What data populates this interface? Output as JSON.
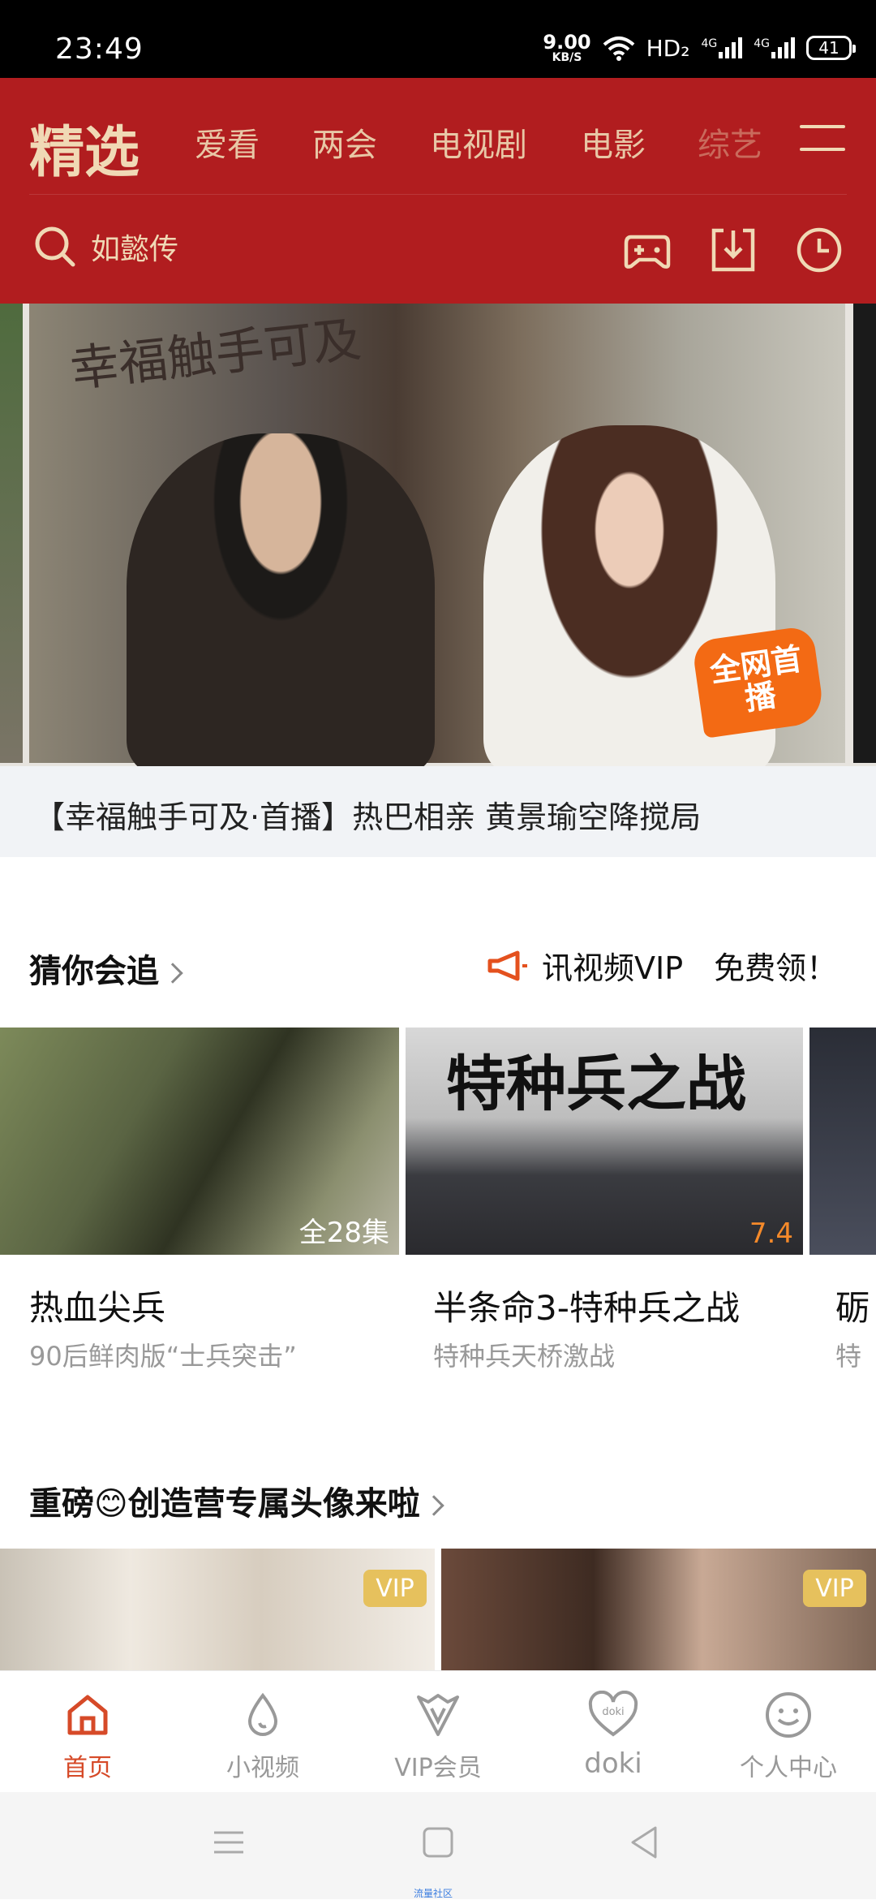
{
  "status_bar": {
    "time": "23:49",
    "net_speed": "9.00",
    "net_unit": "KB/S",
    "hd": "HD₂",
    "signal1": "4G",
    "signal2": "4G",
    "battery": "41"
  },
  "header": {
    "active_tab": "精选",
    "tabs": [
      "爱看",
      "两会",
      "电视剧",
      "电影",
      "综艺"
    ],
    "search_placeholder": "如懿传",
    "accent_color": "#b11d1f"
  },
  "banner": {
    "title_art": "幸福触手可及",
    "badge": "全网首播",
    "caption": "【幸福触手可及·首播】热巴相亲 黄景瑜空降搅局"
  },
  "section_guess": {
    "title": "猜你会追",
    "promo": "讯视频VIP　免费领！",
    "cards": [
      {
        "name": "热血尖兵",
        "sub": "90后鲜肉版“士兵突击”",
        "tag": "全28集"
      },
      {
        "name": "半条命3-特种兵之战",
        "sub": "特种兵天桥激战",
        "tag": "7.4",
        "poster_title": "特种兵之战"
      },
      {
        "name": "砺",
        "sub": "特"
      }
    ]
  },
  "section_avatar": {
    "title": "重磅😊创造营专属头像来啦",
    "cards": [
      {
        "badge": "VIP"
      },
      {
        "badge": "VIP"
      }
    ]
  },
  "tabbar": {
    "items": [
      {
        "label": "首页",
        "icon": "home-icon",
        "active": true
      },
      {
        "label": "小视频",
        "icon": "droplet-icon"
      },
      {
        "label": "VIP会员",
        "icon": "vip-icon"
      },
      {
        "label": "doki",
        "icon": "doki-heart-icon"
      },
      {
        "label": "个人中心",
        "icon": "smiley-icon"
      }
    ]
  },
  "nav_bar": {
    "label": "流量社区"
  }
}
